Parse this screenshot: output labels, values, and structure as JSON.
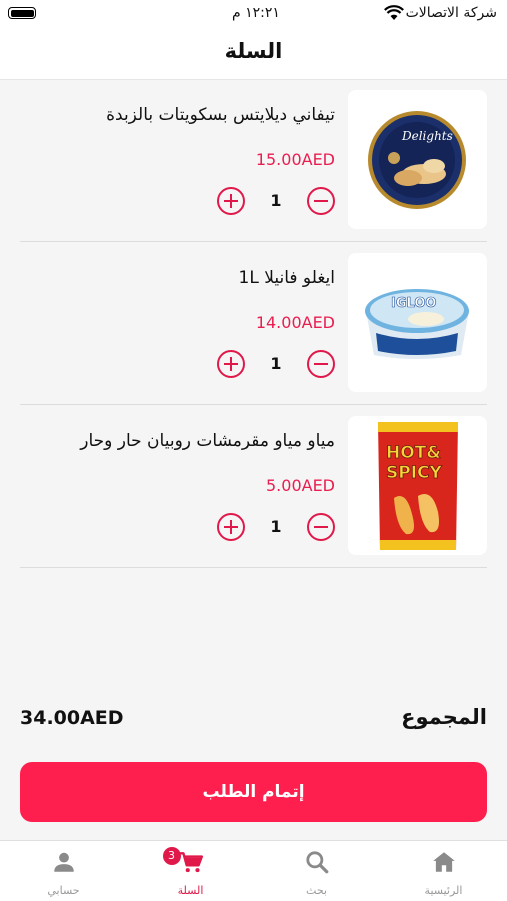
{
  "status_bar": {
    "carrier": "شركة الاتصالات",
    "time": "١٢:٢١ م"
  },
  "header": {
    "title": "السلة"
  },
  "cart": {
    "items": [
      {
        "name": "تيفاني ديلايتس بسكويتات بالزبدة",
        "price": "15.00AED",
        "quantity": "1",
        "image": "tin-biscuits"
      },
      {
        "name": "ايغلو فانيلا 1L",
        "price": "14.00AED",
        "quantity": "1",
        "image": "ice-cream-tub"
      },
      {
        "name": "مياو مياو مقرمشات روبيان حار وحار",
        "price": "5.00AED",
        "quantity": "1",
        "image": "chips-bag"
      }
    ]
  },
  "summary": {
    "label": "المجموع",
    "total": "34.00AED"
  },
  "checkout": {
    "label": "إتمام الطلب"
  },
  "nav": {
    "items": [
      {
        "label": "الرئيسية",
        "icon": "home-icon"
      },
      {
        "label": "بحث",
        "icon": "search-icon"
      },
      {
        "label": "السلة",
        "icon": "cart-icon",
        "badge": "3",
        "active": true
      },
      {
        "label": "حسابي",
        "icon": "person-icon"
      }
    ]
  },
  "colors": {
    "accent": "#e0194a",
    "button": "#ff1f4f",
    "background": "#f5f5f5"
  }
}
